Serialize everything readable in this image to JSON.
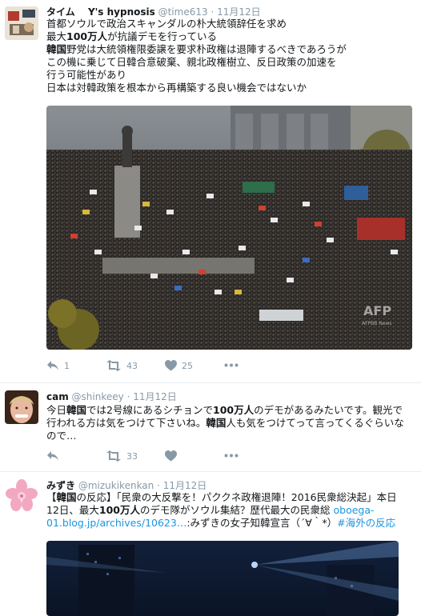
{
  "tweets": [
    {
      "name": "タイム　 Y's hypnosis",
      "handle": "@time613",
      "time": "11月12日",
      "lines": [
        "首都ソウルで政治スキャンダルの朴大統領辞任を求め",
        [
          "最大",
          {
            "b": "100万人"
          },
          "が抗議デモを行っている"
        ],
        [
          {
            "b": "韓国"
          },
          "野党は大統領権限委譲を要求朴政権は退陣するべきであろうが"
        ],
        "この機に乗じて日韓合意破棄、親北政権樹立、反日政策の加速を",
        "行う可能性があり",
        "日本は対韓政策を根本から再構築する良い機会ではないか"
      ],
      "media_watermark": "AFPBB News",
      "actions": {
        "reply": "1",
        "retweet": "43",
        "like": "25"
      }
    },
    {
      "name": "cam",
      "handle": "@shinkeey",
      "time": "11月12日",
      "lines": [
        [
          "今日",
          {
            "b": "韓国"
          },
          "では2号線にあるシチョンで",
          {
            "b": "100万人"
          },
          "のデモがあるみたいです。観光で"
        ],
        [
          "行われる方は気をつけて下さいね。",
          {
            "b": "韓国"
          },
          "人も気をつけてって言ってくるぐらいな"
        ],
        "ので…"
      ],
      "actions": {
        "reply": "",
        "retweet": "33",
        "like": ""
      }
    },
    {
      "name": "みずき",
      "handle": "@mizukikenkan",
      "time": "11月12日",
      "lines": [
        [
          "【",
          {
            "b": "韓国"
          },
          "の反応】「民衆の大反撃を！パククネ政権退陣！2016民衆総決起」本日"
        ],
        [
          "12日、最大",
          {
            "b": "100万人"
          },
          "のデモ隊がソウル集結？歴代最大の民衆総 ",
          {
            "link": "oboega-"
          }
        ],
        [
          {
            "link": "01.blog.jp/archives/10623…"
          },
          ":みずきの女子知韓宣言（´∀｀*）",
          {
            "link": "#海外の反応"
          }
        ]
      ]
    }
  ],
  "colors": {
    "text": "#14171a",
    "meta": "#8899a6",
    "link": "#1b95e0",
    "divider": "#e6ecf0"
  },
  "icons": [
    "reply-icon",
    "retweet-icon",
    "like-icon",
    "more-icon"
  ]
}
